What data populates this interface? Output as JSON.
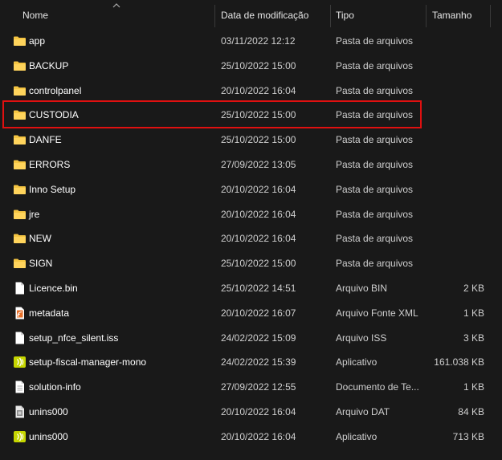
{
  "columns": {
    "name": "Nome",
    "date": "Data de modificação",
    "type": "Tipo",
    "size": "Tamanho"
  },
  "colors": {
    "folder": "#f5c542",
    "highlight": "#e01010",
    "exe": "#c6d600",
    "xml": "#e8702a"
  },
  "files": [
    {
      "name": "app",
      "date": "03/11/2022 12:12",
      "type": "Pasta de arquivos",
      "size": "",
      "icon": "folder-icon"
    },
    {
      "name": "BACKUP",
      "date": "25/10/2022 15:00",
      "type": "Pasta de arquivos",
      "size": "",
      "icon": "folder-icon"
    },
    {
      "name": "controlpanel",
      "date": "20/10/2022 16:04",
      "type": "Pasta de arquivos",
      "size": "",
      "icon": "folder-icon"
    },
    {
      "name": "CUSTODIA",
      "date": "25/10/2022 15:00",
      "type": "Pasta de arquivos",
      "size": "",
      "icon": "folder-icon"
    },
    {
      "name": "DANFE",
      "date": "25/10/2022 15:00",
      "type": "Pasta de arquivos",
      "size": "",
      "icon": "folder-icon"
    },
    {
      "name": "ERRORS",
      "date": "27/09/2022 13:05",
      "type": "Pasta de arquivos",
      "size": "",
      "icon": "folder-icon"
    },
    {
      "name": "Inno Setup",
      "date": "20/10/2022 16:04",
      "type": "Pasta de arquivos",
      "size": "",
      "icon": "folder-icon"
    },
    {
      "name": "jre",
      "date": "20/10/2022 16:04",
      "type": "Pasta de arquivos",
      "size": "",
      "icon": "folder-icon"
    },
    {
      "name": "NEW",
      "date": "20/10/2022 16:04",
      "type": "Pasta de arquivos",
      "size": "",
      "icon": "folder-icon"
    },
    {
      "name": "SIGN",
      "date": "25/10/2022 15:00",
      "type": "Pasta de arquivos",
      "size": "",
      "icon": "folder-icon"
    },
    {
      "name": "Licence.bin",
      "date": "25/10/2022 14:51",
      "type": "Arquivo BIN",
      "size": "2 KB",
      "icon": "file-icon"
    },
    {
      "name": "metadata",
      "date": "20/10/2022 16:07",
      "type": "Arquivo Fonte XML",
      "size": "1 KB",
      "icon": "xml-file-icon"
    },
    {
      "name": "setup_nfce_silent.iss",
      "date": "24/02/2022 15:09",
      "type": "Arquivo ISS",
      "size": "3 KB",
      "icon": "file-icon"
    },
    {
      "name": "setup-fiscal-manager-mono",
      "date": "24/02/2022 15:39",
      "type": "Aplicativo",
      "size": "161.038 KB",
      "icon": "application-icon"
    },
    {
      "name": "solution-info",
      "date": "27/09/2022 12:55",
      "type": "Documento de Te...",
      "size": "1 KB",
      "icon": "text-file-icon"
    },
    {
      "name": "unins000",
      "date": "20/10/2022 16:04",
      "type": "Arquivo DAT",
      "size": "84 KB",
      "icon": "dat-file-icon"
    },
    {
      "name": "unins000",
      "date": "20/10/2022 16:04",
      "type": "Aplicativo",
      "size": "713 KB",
      "icon": "application-icon"
    }
  ]
}
